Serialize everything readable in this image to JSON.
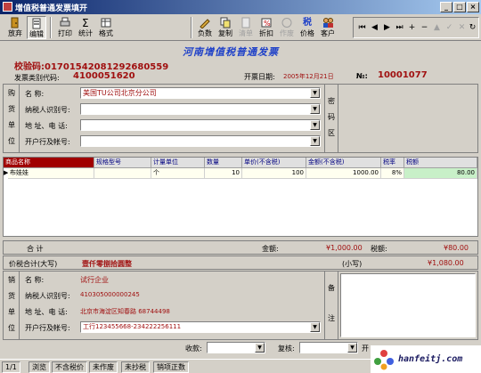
{
  "window": {
    "title": "增值税普通发票填开"
  },
  "toolbar": {
    "buttons": [
      {
        "label": "放弃"
      },
      {
        "label": "编辑"
      },
      {
        "label": "打印"
      },
      {
        "label": "统计"
      },
      {
        "label": "格式"
      },
      {
        "label": "负数"
      },
      {
        "label": "复制"
      },
      {
        "label": "清单"
      },
      {
        "label": "折扣"
      },
      {
        "label": "作废"
      },
      {
        "label": "价格"
      },
      {
        "label": "客户"
      }
    ],
    "tax_glyph": "税"
  },
  "invoice": {
    "title": "河南增值税普通发票",
    "check_code_label": "校验码:",
    "check_code": "01701542081292680559",
    "type_code_label": "发票类别代码:",
    "type_code": "4100051620",
    "date_label": "开票日期:",
    "date": "2005年12月21日",
    "no_label": "№:",
    "no": "10001077"
  },
  "buyer": {
    "side_label": [
      "购",
      "货",
      "单",
      "位"
    ],
    "fields": [
      {
        "label": "名       称:",
        "value": "美国TU公司北京分公司"
      },
      {
        "label": "纳税人识别号:",
        "value": ""
      },
      {
        "label": "地 址、电 话:",
        "value": ""
      },
      {
        "label": "开户行及帐号:",
        "value": ""
      }
    ],
    "cipher_label": [
      "密",
      "码",
      "区"
    ]
  },
  "items": {
    "headers": [
      "商品名称",
      "规格型号",
      "计量单位",
      "数量",
      "单价(不含税)",
      "金额(不含税)",
      "税率",
      "税额"
    ],
    "rows": [
      {
        "name": "布娃娃",
        "spec": "",
        "unit": "个",
        "qty": "10",
        "price": "100",
        "amount": "1000.00",
        "rate": "8%",
        "tax": "80.00"
      }
    ]
  },
  "totals": {
    "sum_label": "合        计",
    "amount_label": "金额:",
    "amount": "¥1,000.00",
    "tax_label": "税额:",
    "tax": "¥80.00",
    "total_label": "价税合计(大写)",
    "total_words": "壹仟零捌拾圆整",
    "small_label": "(小写)",
    "total_small": "¥1,080.00"
  },
  "seller": {
    "side_label": [
      "销",
      "货",
      "单",
      "位"
    ],
    "fields": [
      {
        "label": "名       称:",
        "value": "试行企业"
      },
      {
        "label": "纳税人识别号:",
        "value": "410305000000245"
      },
      {
        "label": "地 址、电 话:",
        "value": "北京市海淀区知春路 68744498"
      },
      {
        "label": "开户行及帐号:",
        "value": "工行123455668-234222256111"
      }
    ],
    "notes_label": [
      "备",
      "注"
    ]
  },
  "footer": {
    "payee_label": "收款:",
    "reviewer_label": "复核:",
    "drawer_label": "开"
  },
  "status": [
    "1/1",
    "浏览",
    "不含税价",
    "未作废",
    "未抄税",
    "销项正数"
  ],
  "watermark": "hanfeitj.com"
}
